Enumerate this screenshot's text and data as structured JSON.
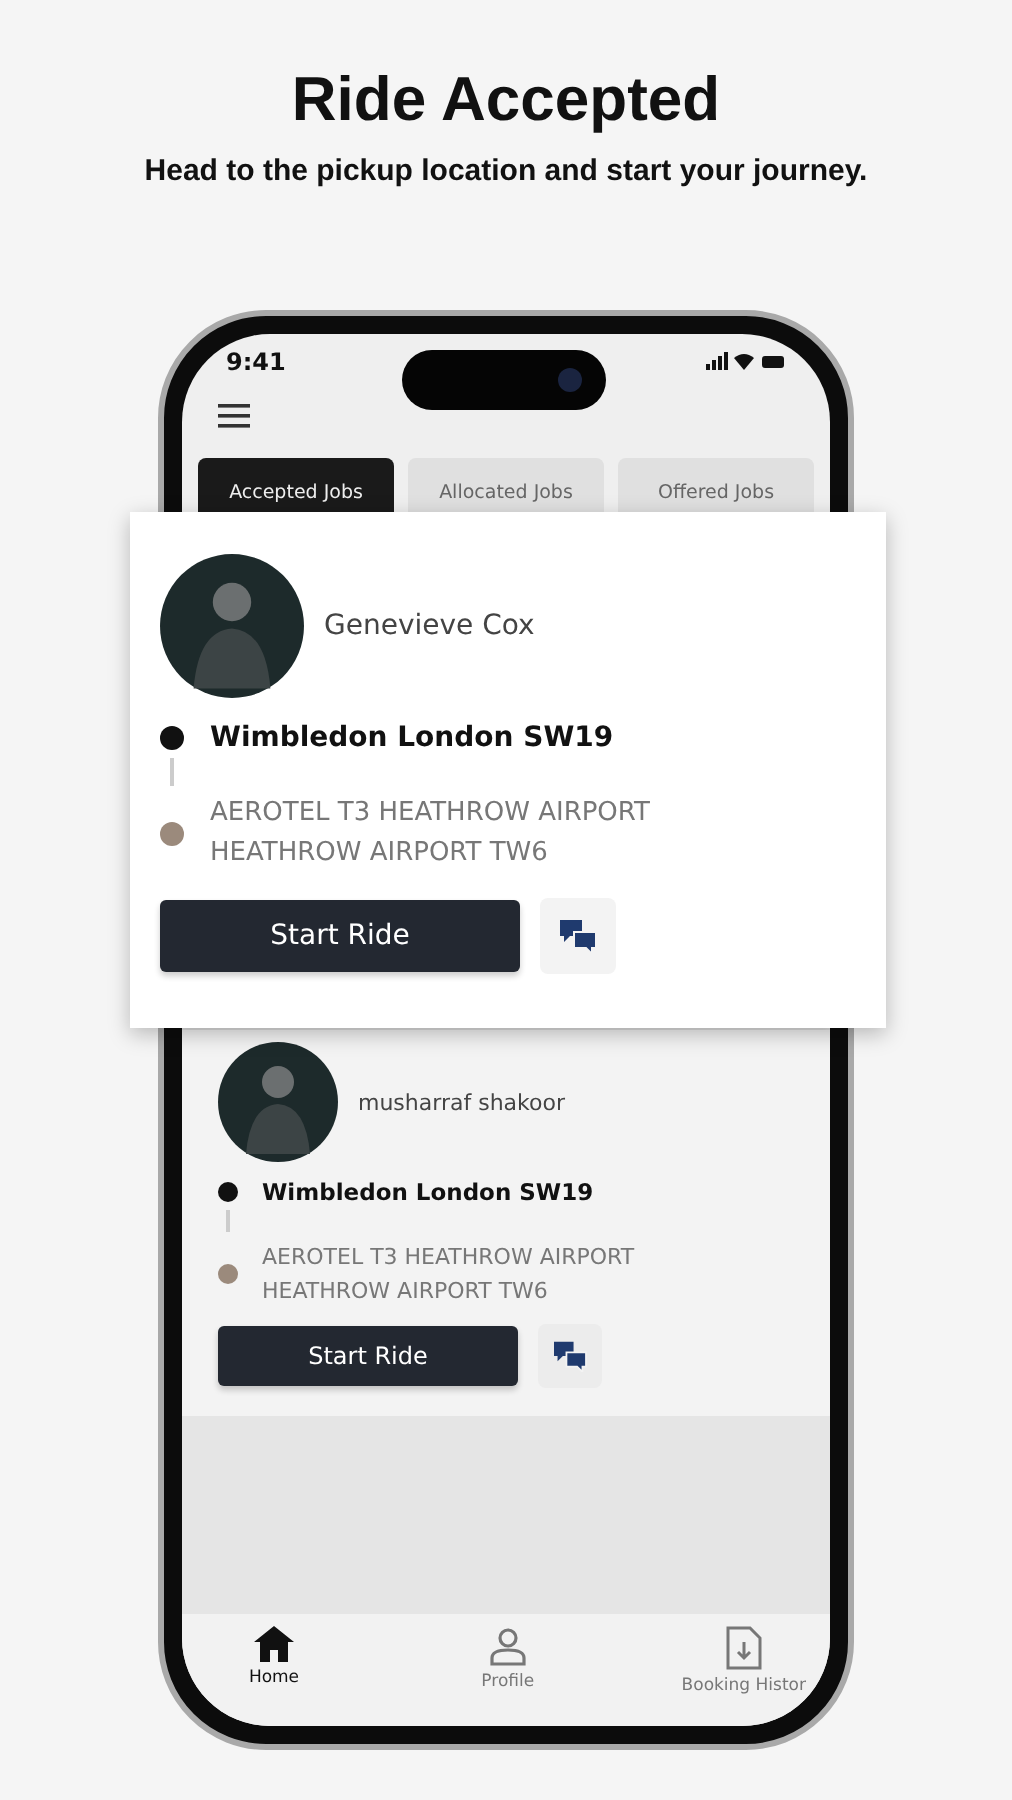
{
  "header": {
    "title": "Ride Accepted",
    "subtitle": "Head to the pickup location and start your journey."
  },
  "phone": {
    "status_bar": {
      "time": "9:41"
    },
    "tabs": [
      {
        "label": "Accepted Jobs",
        "selected": true
      },
      {
        "label": "Allocated Jobs",
        "selected": false
      },
      {
        "label": "Offered Jobs",
        "selected": false
      }
    ],
    "jobs": [
      {
        "name": "musharraf shakoor",
        "pickup": "Wimbledon London SW19",
        "dropoff": "AEROTEL T3 HEATHROW AIRPORT HEATHROW AIRPORT TW6",
        "button": "Start Ride"
      }
    ],
    "bottom_nav": [
      {
        "label": "Home",
        "kind": "home",
        "selected": true
      },
      {
        "label": "Profile",
        "kind": "profile",
        "selected": false
      },
      {
        "label": "Booking Histor",
        "kind": "history",
        "selected": false
      }
    ]
  },
  "popup_job": {
    "name": "Genevieve Cox",
    "pickup": "Wimbledon London SW19",
    "dropoff": "AEROTEL T3 HEATHROW AIRPORT HEATHROW AIRPORT TW6",
    "button": "Start Ride"
  }
}
